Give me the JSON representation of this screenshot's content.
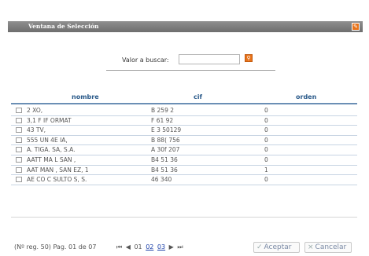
{
  "window": {
    "title": "Ventana de Selección",
    "close_glyph": "✎"
  },
  "search": {
    "label": "Valor a buscar:",
    "value": "",
    "button_glyph": "⚲"
  },
  "table": {
    "columns": [
      "nombre",
      "cif",
      "orden"
    ],
    "rows": [
      {
        "nombre": "2   XO,",
        "cif": "B 259  2",
        "orden": "0"
      },
      {
        "nombre": "3,1   F  IF ORMAT",
        "cif": "F 61 92",
        "orden": "0"
      },
      {
        "nombre": "43 TV,",
        "cif": "E 3 50129",
        "orden": "0"
      },
      {
        "nombre": "555 UN 4E IA,",
        "cif": "B 88( 756",
        "orden": "0"
      },
      {
        "nombre": "A.  TIGA.  SA, S.A.",
        "cif": "A 30f 207",
        "orden": "0"
      },
      {
        "nombre": "AATT MA   L SAN    ,",
        "cif": "B4 51 36",
        "orden": "0"
      },
      {
        "nombre": "AAT  MAN  , SAN EZ, 1",
        "cif": "B4  51  36",
        "orden": "1"
      },
      {
        "nombre": "AE  CO C   SULTO  S, S.",
        "cif": "46 340",
        "orden": "0"
      }
    ]
  },
  "pagination": {
    "info": "(Nº reg. 50) Pag. 01 de 07",
    "first_glyph": "⏮",
    "prev_glyph": "◀",
    "current": "01",
    "pages": [
      "02",
      "03"
    ],
    "next_glyph": "▶",
    "last_glyph": "⏭"
  },
  "buttons": {
    "accept_glyph": "✓",
    "accept_label": "Aceptar",
    "cancel_glyph": "×",
    "cancel_label": "Cancelar"
  },
  "colors": {
    "title_bar": "#7f7f7f",
    "accent_orange": "#e8731a",
    "header_text": "#2a5a8a",
    "link": "#1a3fa8"
  }
}
